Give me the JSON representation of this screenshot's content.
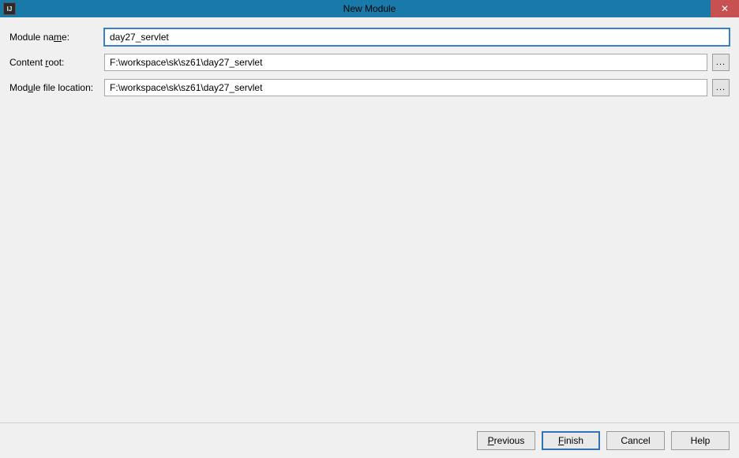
{
  "window": {
    "title": "New Module",
    "app_icon_text": "IJ"
  },
  "form": {
    "module_name": {
      "label_pre": "Module na",
      "label_mnemonic": "m",
      "label_post": "e:",
      "value": "day27_servlet"
    },
    "content_root": {
      "label_pre": "Content ",
      "label_mnemonic": "r",
      "label_post": "oot:",
      "value": "F:\\workspace\\sk\\sz61\\day27_servlet",
      "browse": "..."
    },
    "module_file_location": {
      "label_pre": "Mod",
      "label_mnemonic": "u",
      "label_post": "le file location:",
      "value": "F:\\workspace\\sk\\sz61\\day27_servlet",
      "browse": "..."
    }
  },
  "buttons": {
    "previous_mnemonic": "P",
    "previous_post": "revious",
    "finish_mnemonic": "F",
    "finish_post": "inish",
    "cancel": "Cancel",
    "help": "Help"
  }
}
